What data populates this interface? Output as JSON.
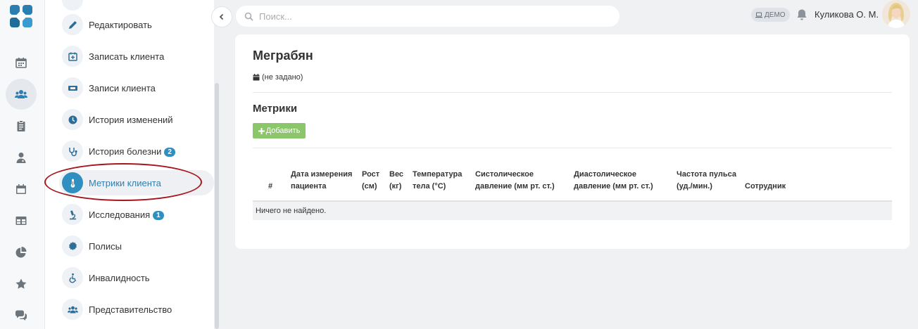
{
  "rail": {
    "items": [
      {
        "icon": "calendar-icon"
      },
      {
        "icon": "users-icon",
        "active": true
      },
      {
        "icon": "clipboard-icon"
      },
      {
        "icon": "doctor-icon"
      },
      {
        "icon": "calendar-day-icon"
      },
      {
        "icon": "table-icon"
      },
      {
        "icon": "pie-chart-icon"
      },
      {
        "icon": "star-icon"
      },
      {
        "icon": "chat-icon"
      }
    ]
  },
  "subnav": {
    "items": [
      {
        "label": "Редактировать",
        "icon": "pencil-icon"
      },
      {
        "label": "Записать клиента",
        "icon": "calendar-plus-icon"
      },
      {
        "label": "Записи клиента",
        "icon": "ticket-icon"
      },
      {
        "label": "История изменений",
        "icon": "clock-icon"
      },
      {
        "label": "История болезни",
        "icon": "stethoscope-icon",
        "badge": "2"
      },
      {
        "label": "Метрики клиента",
        "icon": "thermometer-icon",
        "active": true
      },
      {
        "label": "Исследования",
        "icon": "microscope-icon",
        "badge": "1"
      },
      {
        "label": "Полисы",
        "icon": "certificate-icon"
      },
      {
        "label": "Инвалидность",
        "icon": "wheelchair-icon"
      },
      {
        "label": "Представительство",
        "icon": "users-icon"
      }
    ]
  },
  "topbar": {
    "search_placeholder": "Поиск...",
    "demo_label": "ДЕМО",
    "user_name": "Куликова О. М."
  },
  "patient": {
    "name": "Меграбян",
    "dob": "(не задано)"
  },
  "metrics": {
    "title": "Метрики",
    "add_label": "Добавить",
    "columns": [
      "#",
      "Дата измерения пациента",
      "Рост (см)",
      "Вес (кг)",
      "Температура тела (°C)",
      "Систолическое давление (мм рт. ст.)",
      "Диастолическое давление (мм рт. ст.)",
      "Частота пульса (уд./мин.)",
      "Сотрудник"
    ],
    "empty_text": "Ничего не найдено."
  },
  "colors": {
    "accent": "#2e8fc0",
    "add_button": "#8cc66b",
    "highlight": "#a5171c"
  }
}
